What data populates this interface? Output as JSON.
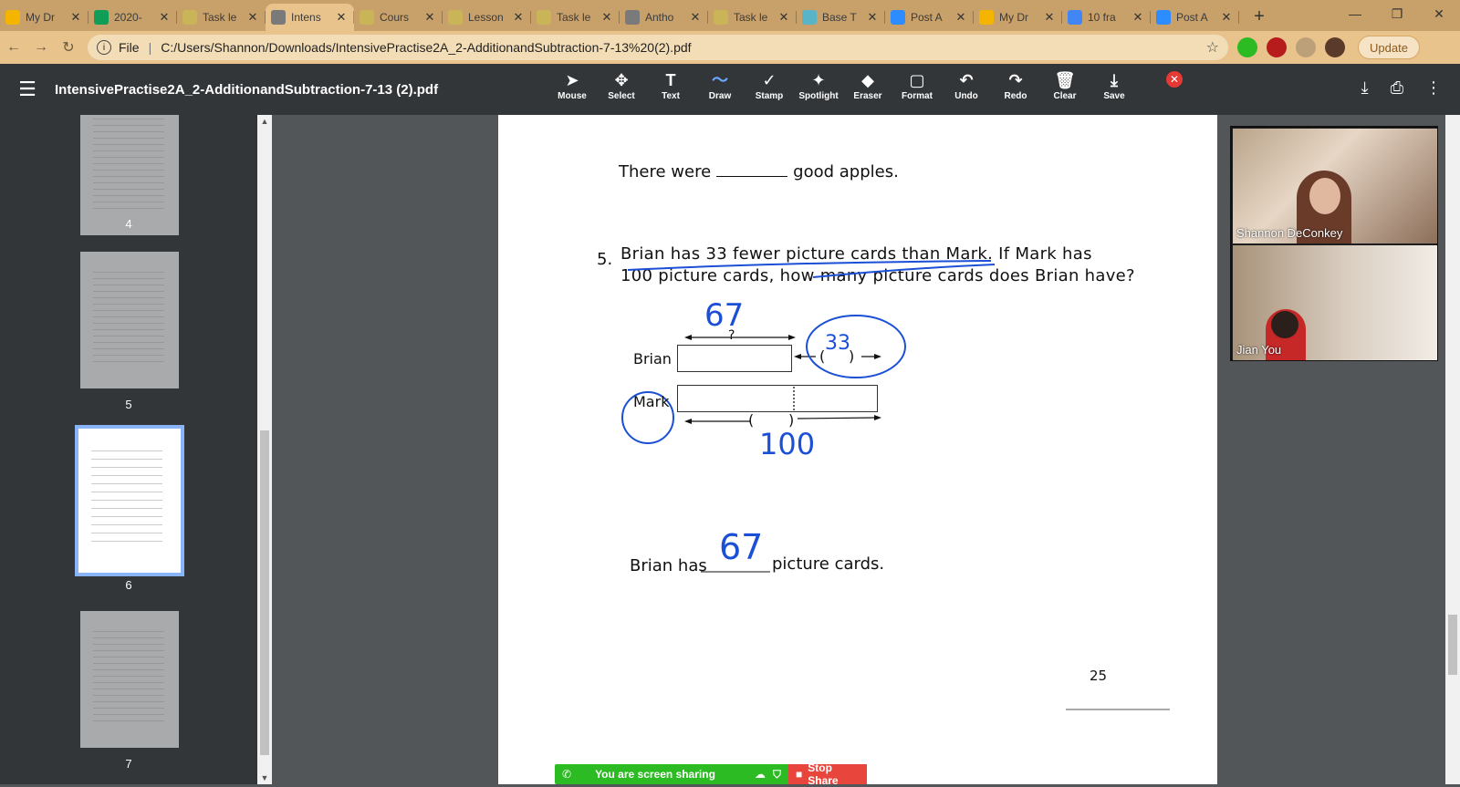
{
  "browser": {
    "tabs": [
      {
        "title": "My Dr",
        "icon": "google-drive-icon",
        "color": "#f4b400"
      },
      {
        "title": "2020-",
        "icon": "google-sheets-icon",
        "color": "#0f9d58"
      },
      {
        "title": "Task le",
        "icon": "classroom-icon",
        "color": "#c9b458"
      },
      {
        "title": "Intens",
        "icon": "globe-icon",
        "color": "#7a7a7a",
        "active": true
      },
      {
        "title": "Cours",
        "icon": "classroom-icon",
        "color": "#c9b458"
      },
      {
        "title": "Lesson",
        "icon": "classroom-icon",
        "color": "#c9b458"
      },
      {
        "title": "Task le",
        "icon": "classroom-icon",
        "color": "#c9b458"
      },
      {
        "title": "Antho",
        "icon": "globe-icon",
        "color": "#7a7a7a"
      },
      {
        "title": "Task le",
        "icon": "classroom-icon",
        "color": "#c9b458"
      },
      {
        "title": "Base T",
        "icon": "base-ten-icon",
        "color": "#5ab4c8"
      },
      {
        "title": "Post A",
        "icon": "zoom-icon",
        "color": "#2d8cff"
      },
      {
        "title": "My Dr",
        "icon": "google-drive-icon",
        "color": "#f4b400"
      },
      {
        "title": "10 fra",
        "icon": "google-docs-icon",
        "color": "#4285f4"
      },
      {
        "title": "Post A",
        "icon": "zoom-icon",
        "color": "#2d8cff"
      }
    ],
    "url_scheme": "File",
    "url": "C:/Users/Shannon/Downloads/IntensivePractise2A_2-AdditionandSubtraction-7-13%20(2).pdf",
    "update_label": "Update"
  },
  "pdf_viewer": {
    "title": "IntensivePractise2A_2-AdditionandSubtraction-7-13 (2).pdf",
    "tools": [
      {
        "label": "Mouse",
        "glyph": "➤",
        "icon": "cursor-icon"
      },
      {
        "label": "Select",
        "glyph": "✥",
        "icon": "move-icon"
      },
      {
        "label": "Text",
        "glyph": "T",
        "icon": "text-icon"
      },
      {
        "label": "Draw",
        "glyph": "〜",
        "icon": "draw-icon",
        "active": true
      },
      {
        "label": "Stamp",
        "glyph": "✓",
        "icon": "stamp-icon"
      },
      {
        "label": "Spotlight",
        "glyph": "✦",
        "icon": "spotlight-icon"
      },
      {
        "label": "Eraser",
        "glyph": "◆",
        "icon": "eraser-icon"
      },
      {
        "label": "Format",
        "glyph": "▢",
        "icon": "format-icon"
      },
      {
        "label": "Undo",
        "glyph": "↶",
        "icon": "undo-icon"
      },
      {
        "label": "Redo",
        "glyph": "↷",
        "icon": "redo-icon"
      },
      {
        "label": "Clear",
        "glyph": "🗑",
        "icon": "trash-icon"
      },
      {
        "label": "Save",
        "glyph": "⤓",
        "icon": "save-icon"
      }
    ],
    "thumbnails": [
      {
        "page": "4"
      },
      {
        "page": "5"
      },
      {
        "page": "6",
        "selected": true
      },
      {
        "page": "7"
      }
    ]
  },
  "page": {
    "line1_before": "There were",
    "line1_after": "good apples.",
    "q_number": "5.",
    "q_line1": "Brian has 33 fewer picture cards than Mark. If Mark has",
    "q_line2": "100 picture cards, how many picture cards does Brian have?",
    "label_brian": "Brian",
    "label_mark": "Mark",
    "question_mark": "?",
    "ink_top": "67",
    "ink_circle": "33",
    "ink_bottom": "100",
    "answer_before": "Brian has",
    "answer_ink": "67",
    "answer_after": "picture cards.",
    "page_number": "25"
  },
  "meeting": {
    "participants": [
      {
        "name": "Shannon DeConkey"
      },
      {
        "name": "Jian You"
      }
    ],
    "share_status": "You are screen sharing",
    "stop_label": "Stop Share"
  }
}
